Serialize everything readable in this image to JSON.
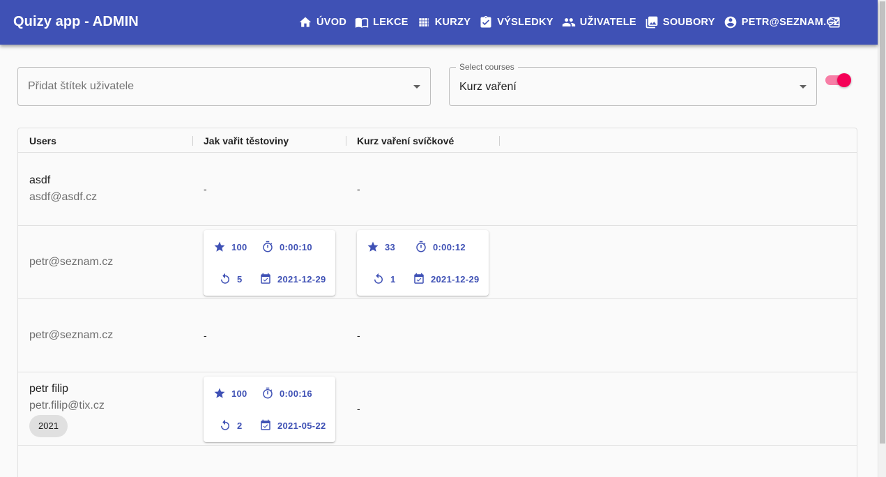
{
  "app": {
    "title": "Quizy app - ADMIN"
  },
  "nav": [
    {
      "icon": "home-icon",
      "label": "ÚVOD"
    },
    {
      "icon": "book-icon",
      "label": "LEKCE"
    },
    {
      "icon": "grid-icon",
      "label": "KURZY"
    },
    {
      "icon": "clipboard-check-icon",
      "label": "VÝSLEDKY"
    },
    {
      "icon": "people-icon",
      "label": "UŽIVATELE"
    },
    {
      "icon": "photo-library-icon",
      "label": "SOUBORY"
    },
    {
      "icon": "account-circle-icon",
      "label": "PETR@SEZNAM.CZ"
    }
  ],
  "filters": {
    "tag_placeholder": "Přidat štítek uživatele",
    "courses_label": "Select courses",
    "courses_value": "Kurz vaření",
    "toggle_on": true
  },
  "table": {
    "columns": [
      "Users",
      "Jak vařit těstoviny",
      "Kurz vaření svíčkové"
    ],
    "rows": [
      {
        "name": "asdf",
        "email": "asdf@asdf.cz",
        "tag": "",
        "c1": "-",
        "c2": "-"
      },
      {
        "name": "",
        "email": "petr@seznam.cz",
        "tag": "",
        "r1": {
          "score": "100",
          "time": "0:00:10",
          "attempts": "5",
          "date": "2021-12-29"
        },
        "r2": {
          "score": "33",
          "time": "0:00:12",
          "attempts": "1",
          "date": "2021-12-29"
        }
      },
      {
        "name": "",
        "email": "petr@seznam.cz",
        "tag": "",
        "c1": "-",
        "c2": "-"
      },
      {
        "name": "petr filip",
        "email": "petr.filip@tix.cz",
        "tag": "2021",
        "r1": {
          "score": "100",
          "time": "0:00:16",
          "attempts": "2",
          "date": "2021-05-22"
        },
        "c2": "-"
      }
    ]
  },
  "colors": {
    "primary": "#3f51b5",
    "accent": "#f50057"
  }
}
